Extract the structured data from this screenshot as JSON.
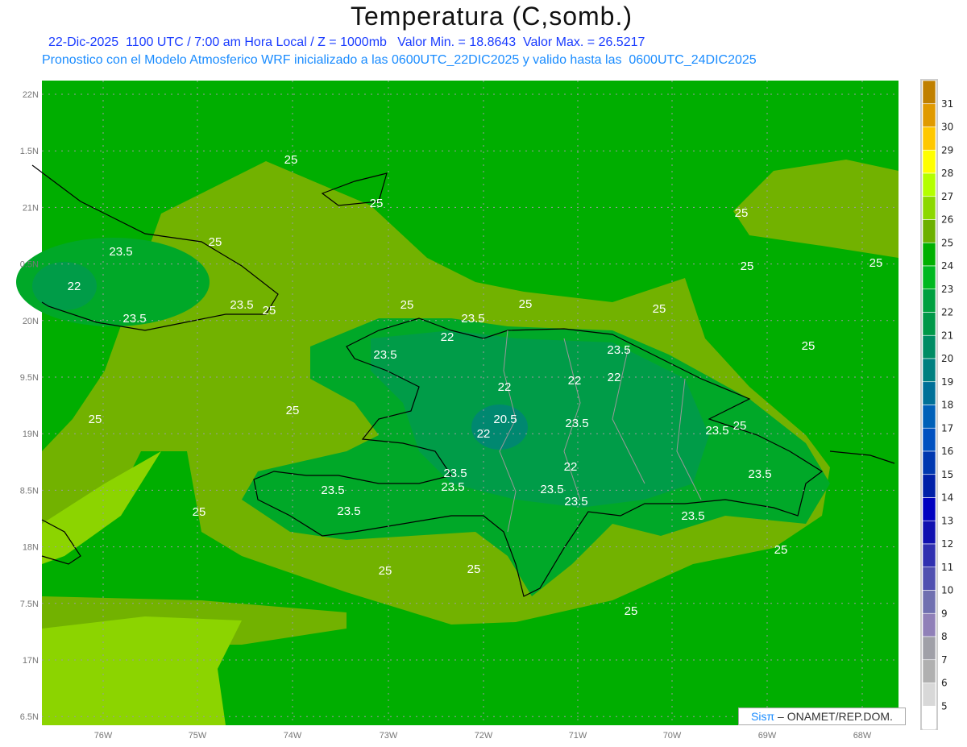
{
  "title": "Temperatura (C,somb.)",
  "subtitle_line1": "22-Dic-2025  1100 UTC / 7:00 am Hora Local / Z = 1000mb   Valor Min. = 18.8643  Valor Max. = 26.5217",
  "subtitle_line2": "Pronostico con el Modelo Atmosferico WRF inicializado a las 0600UTC_22DIC2025 y valido hasta las  0600UTC_24DIC2025",
  "map": {
    "lon_ticks": [
      "76W",
      "75W",
      "74W",
      "73W",
      "72W",
      "71W",
      "70W",
      "69W",
      "68W"
    ],
    "lat_ticks": [
      "22N",
      "1.5N",
      "21N",
      "0.5N",
      "20N",
      "9.5N",
      "19N",
      "8.5N",
      "18N",
      "7.5N",
      "17N",
      "6.5N"
    ],
    "contour_labels": [
      "25",
      "25",
      "25",
      "23.5",
      "22",
      "23.5",
      "25",
      "23.5",
      "25",
      "25",
      "25",
      "25",
      "23.5",
      "25",
      "25",
      "25",
      "22",
      "23.5",
      "23.5",
      "22",
      "22",
      "22",
      "25",
      "25",
      "20.5",
      "23.5",
      "22",
      "23.5",
      "25",
      "23.5",
      "22",
      "23.5",
      "23.5",
      "23.5",
      "23.5",
      "23.5",
      "25",
      "23.5",
      "23.5",
      "25",
      "25",
      "25",
      "25"
    ],
    "field_colors": {
      "t24_25": "#00ae00",
      "t25_26": "#72b200",
      "t26_27": "#8cd400",
      "t23_24": "#00a828",
      "t22_23": "#009c48",
      "t20_21": "#008870"
    }
  },
  "colorbar": {
    "labels": [
      "31",
      "30",
      "29",
      "28",
      "27",
      "26",
      "25",
      "24",
      "23",
      "22",
      "21",
      "20",
      "19",
      "18",
      "17",
      "16",
      "15",
      "14",
      "13",
      "12",
      "11",
      "10",
      "9",
      "8",
      "7",
      "6",
      "5"
    ],
    "colors": [
      "#c08000",
      "#e09a00",
      "#ffc800",
      "#ffff00",
      "#b4ff00",
      "#8cd800",
      "#6cb000",
      "#00b000",
      "#00b820",
      "#00a040",
      "#009848",
      "#008c64",
      "#008080",
      "#007098",
      "#0060b8",
      "#0050c0",
      "#0038b0",
      "#0020a8",
      "#0000c0",
      "#1010b0",
      "#3030b0",
      "#5050b0",
      "#7070b0",
      "#9080b8",
      "#a0a0a8",
      "#b0b0b0",
      "#d8d8d8",
      "#ffffff"
    ]
  },
  "logo": {
    "sis": "Sisπ",
    "text": " –  ONAMET/REP.DOM."
  }
}
